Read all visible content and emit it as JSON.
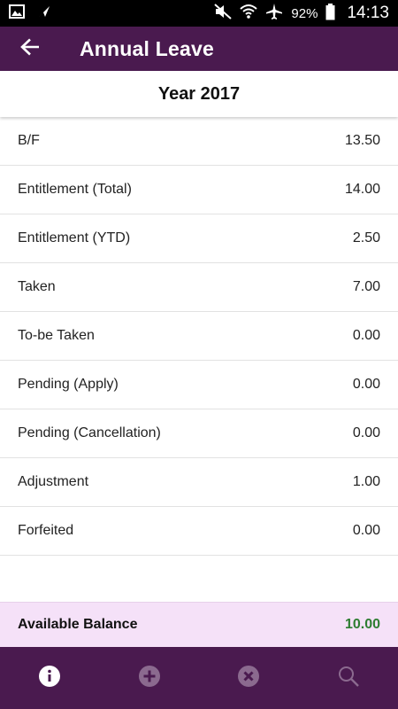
{
  "status_bar": {
    "battery": "92%",
    "time": "14:13"
  },
  "app_bar": {
    "title": "Annual Leave"
  },
  "year_header": {
    "label": "Year 2017"
  },
  "rows": [
    {
      "label": "B/F",
      "value": "13.50"
    },
    {
      "label": "Entitlement (Total)",
      "value": "14.00"
    },
    {
      "label": "Entitlement (YTD)",
      "value": "2.50"
    },
    {
      "label": "Taken",
      "value": "7.00"
    },
    {
      "label": "To-be Taken",
      "value": "0.00"
    },
    {
      "label": "Pending (Apply)",
      "value": "0.00"
    },
    {
      "label": "Pending (Cancellation)",
      "value": "0.00"
    },
    {
      "label": "Adjustment",
      "value": "1.00"
    },
    {
      "label": "Forfeited",
      "value": "0.00"
    }
  ],
  "balance": {
    "label": "Available Balance",
    "value": "10.00"
  },
  "bottom_nav": {
    "items": [
      {
        "icon": "info-icon",
        "active": true
      },
      {
        "icon": "add-icon",
        "active": false
      },
      {
        "icon": "cancel-icon",
        "active": false
      },
      {
        "icon": "search-icon",
        "active": false
      }
    ]
  },
  "colors": {
    "primary": "#4a1a4f",
    "balance_bg": "#f5e1f8",
    "balance_value": "#2e7d32",
    "nav_active": "#ffffff",
    "nav_inactive": "#8b6a8f"
  }
}
